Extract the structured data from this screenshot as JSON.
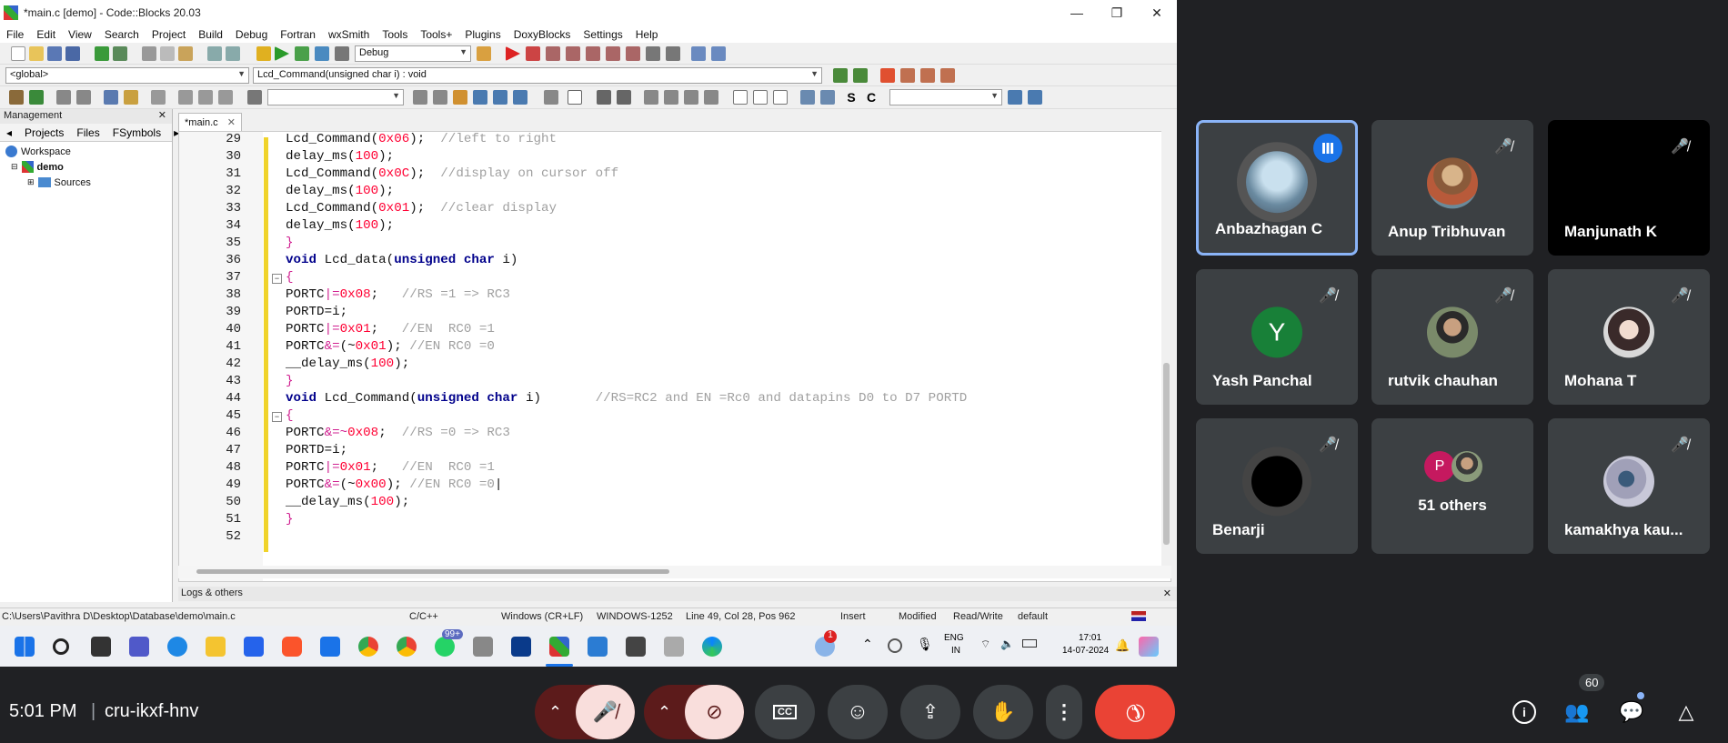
{
  "window": {
    "title": "*main.c [demo] - Code::Blocks 20.03"
  },
  "menu": [
    "File",
    "Edit",
    "View",
    "Search",
    "Project",
    "Build",
    "Debug",
    "Fortran",
    "wxSmith",
    "Tools",
    "Tools+",
    "Plugins",
    "DoxyBlocks",
    "Settings",
    "Help"
  ],
  "toolbar": {
    "build_target": "Debug",
    "scope": "<global>",
    "function": "Lcd_Command(unsigned char i) : void"
  },
  "management": {
    "title": "Management",
    "tabs": [
      "Projects",
      "Files",
      "FSymbols"
    ],
    "tree": [
      "Workspace",
      "demo",
      "Sources"
    ]
  },
  "editor": {
    "tab": "*main.c",
    "line_numbers": [
      "29",
      "30",
      "31",
      "32",
      "33",
      "34",
      "35",
      "36",
      "37",
      "38",
      "39",
      "40",
      "41",
      "42",
      "43",
      "44",
      "45",
      "46",
      "47",
      "48",
      "49",
      "50",
      "51",
      "52"
    ]
  },
  "logs": {
    "title": "Logs & others"
  },
  "status": {
    "path": "C:\\Users\\Pavithra D\\Desktop\\Database\\demo\\main.c",
    "lang": "C/C++",
    "eol": "Windows (CR+LF)",
    "enc": "WINDOWS-1252",
    "pos": "Line 49, Col 28, Pos 962",
    "mode": "Insert",
    "modified": "Modified",
    "rw": "Read/Write",
    "profile": "default"
  },
  "taskbar": {
    "lang1": "ENG",
    "lang2": "IN",
    "time": "17:01",
    "date": "14-07-2024",
    "badge": "99+",
    "notif": "1"
  },
  "participants": [
    {
      "name": "Anbazhagan C",
      "speaking": true
    },
    {
      "name": "Anup Tribhuvan",
      "muted": true
    },
    {
      "name": "Manjunath K",
      "muted": true
    },
    {
      "name": "Yash Panchal",
      "muted": true,
      "initial": "Y"
    },
    {
      "name": "rutvik chauhan",
      "muted": true
    },
    {
      "name": "Mohana T",
      "muted": true
    },
    {
      "name": "Benarji",
      "muted": true
    },
    {
      "name": "51 others",
      "initial": "P"
    },
    {
      "name": "kamakhya kau...",
      "muted": true
    }
  ],
  "meeting": {
    "time": "5:01 PM",
    "code": "cru-ikxf-hnv",
    "people_count": "60"
  },
  "colors": {
    "accent": "#8ab4f8",
    "end_call": "#ea4335",
    "muted_bg": "#5c1b1b",
    "tile_bg": "#3c4043",
    "yash_avatar": "#188038",
    "others_avatar": "#c5195f"
  }
}
